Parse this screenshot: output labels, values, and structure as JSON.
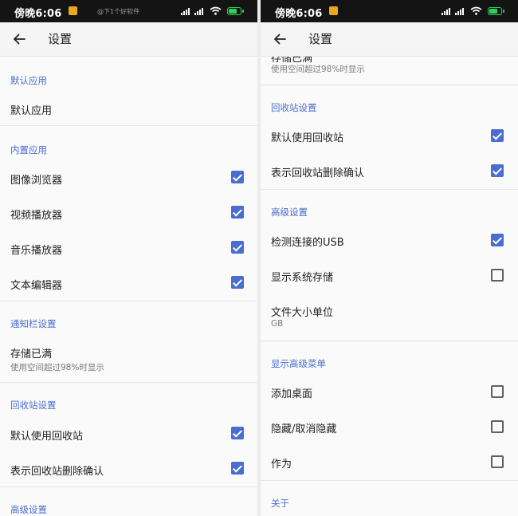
{
  "status": {
    "time": "傍晚6:06",
    "watermark": "@下1个好软件"
  },
  "appbar": {
    "title": "设置"
  },
  "left": {
    "default_apps": {
      "header": "默认应用",
      "item": "默认应用"
    },
    "builtin_apps": {
      "header": "内置应用",
      "items": [
        {
          "label": "图像浏览器",
          "checked": true
        },
        {
          "label": "视频播放器",
          "checked": true
        },
        {
          "label": "音乐播放器",
          "checked": true
        },
        {
          "label": "文本编辑器",
          "checked": true
        }
      ]
    },
    "notification": {
      "header": "通知栏设置",
      "item": "存储已满",
      "sub": "使用空间超过98%时显示"
    },
    "recycle": {
      "header": "回收站设置",
      "items": [
        {
          "label": "默认使用回收站",
          "checked": true
        },
        {
          "label": "表示回收站删除确认",
          "checked": true
        }
      ]
    },
    "advanced": {
      "header": "高级设置"
    }
  },
  "right": {
    "storage_full": {
      "item": "存储已满",
      "sub": "使用空间超过98%时显示"
    },
    "recycle": {
      "header": "回收站设置",
      "items": [
        {
          "label": "默认使用回收站",
          "checked": true
        },
        {
          "label": "表示回收站删除确认",
          "checked": true
        }
      ]
    },
    "advanced": {
      "header": "高级设置",
      "items": [
        {
          "label": "检测连接的USB",
          "checked": true
        },
        {
          "label": "显示系统存储",
          "checked": false
        }
      ],
      "file_size_unit": {
        "label": "文件大小单位",
        "value": "GB"
      }
    },
    "advanced_menu": {
      "header": "显示高级菜单",
      "items": [
        {
          "label": "添加桌面",
          "checked": false
        },
        {
          "label": "隐藏/取消隐藏",
          "checked": false
        },
        {
          "label": "作为",
          "checked": false
        }
      ]
    },
    "about": {
      "header": "关于"
    }
  },
  "colors": {
    "accent": "#4a6dd1",
    "status_bar": "#141414",
    "battery": "#2fd15a",
    "notification": "#e9a91a"
  },
  "icons": {
    "back": "arrow-left-icon",
    "signal": "signal-icon",
    "wifi": "wifi-icon",
    "battery": "battery-icon"
  }
}
